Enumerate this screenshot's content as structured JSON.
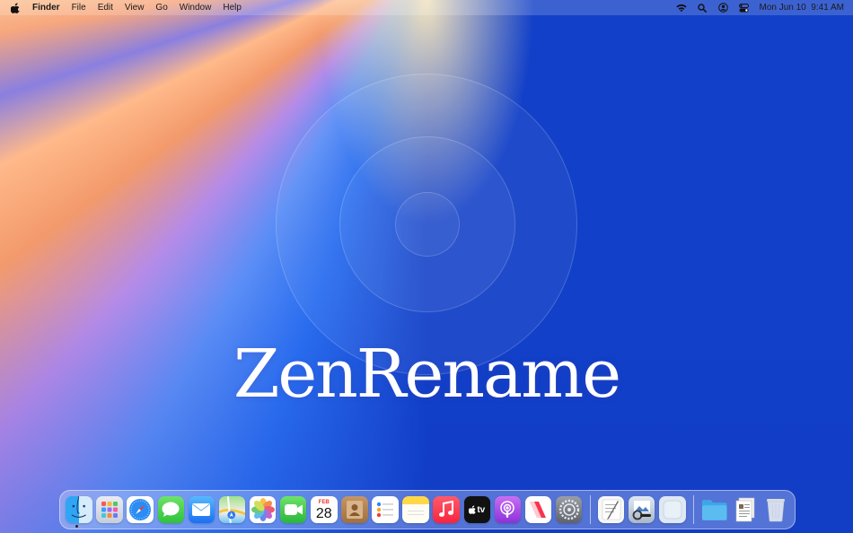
{
  "menubar": {
    "apple_icon": "apple-logo",
    "app_name": "Finder",
    "menus": [
      "File",
      "Edit",
      "View",
      "Go",
      "Window",
      "Help"
    ],
    "status_icons": [
      "wifi-icon",
      "search-icon",
      "user-icon",
      "control-center-icon"
    ],
    "datetime": "Mon Jun 10  9:41 AM"
  },
  "hero": {
    "title": "ZenRename"
  },
  "dock": {
    "apps": [
      "Finder",
      "Launchpad",
      "Safari",
      "Messages",
      "Mail",
      "Maps",
      "Photos",
      "FaceTime",
      "Calendar",
      "Contacts",
      "Reminders",
      "Notes",
      "Music",
      "TV",
      "Podcasts",
      "News",
      "System Settings",
      "TextEdit",
      "Preview",
      "App",
      "Folder",
      "Documents",
      "Trash"
    ],
    "calendar_month": "FEB",
    "calendar_day": "28",
    "tv_label": "tv"
  },
  "colors": {
    "wallpaper_blue": "#1240c8",
    "wallpaper_peach": "#ffb98a",
    "wallpaper_cream": "#fff0cf"
  }
}
